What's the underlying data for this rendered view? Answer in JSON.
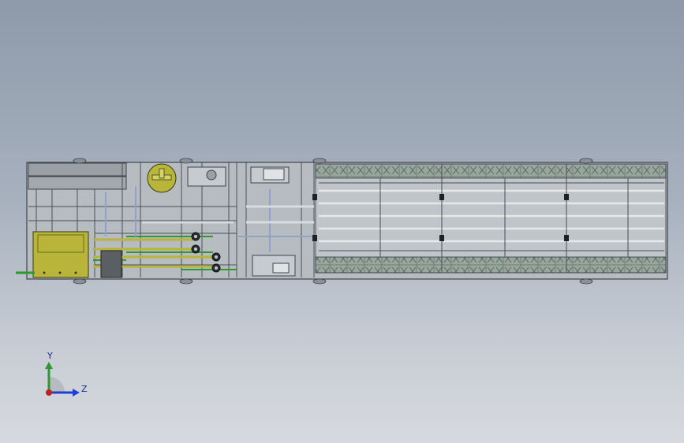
{
  "viewport": {
    "background_top": "#8e9aaa",
    "background_bottom": "#d6d9de"
  },
  "model": {
    "frame_color": "#4a5058",
    "frame_fill": "#b9bdc2",
    "accent_yellow": "#b8b53a",
    "accent_green": "#2e9a2e",
    "conveyor_color": "#6f8a7a"
  },
  "triad": {
    "y_label": "Y",
    "z_label": "Z",
    "y_color": "#2e9a2e",
    "z_color": "#1f3fd0",
    "origin_color": "#c02020"
  }
}
